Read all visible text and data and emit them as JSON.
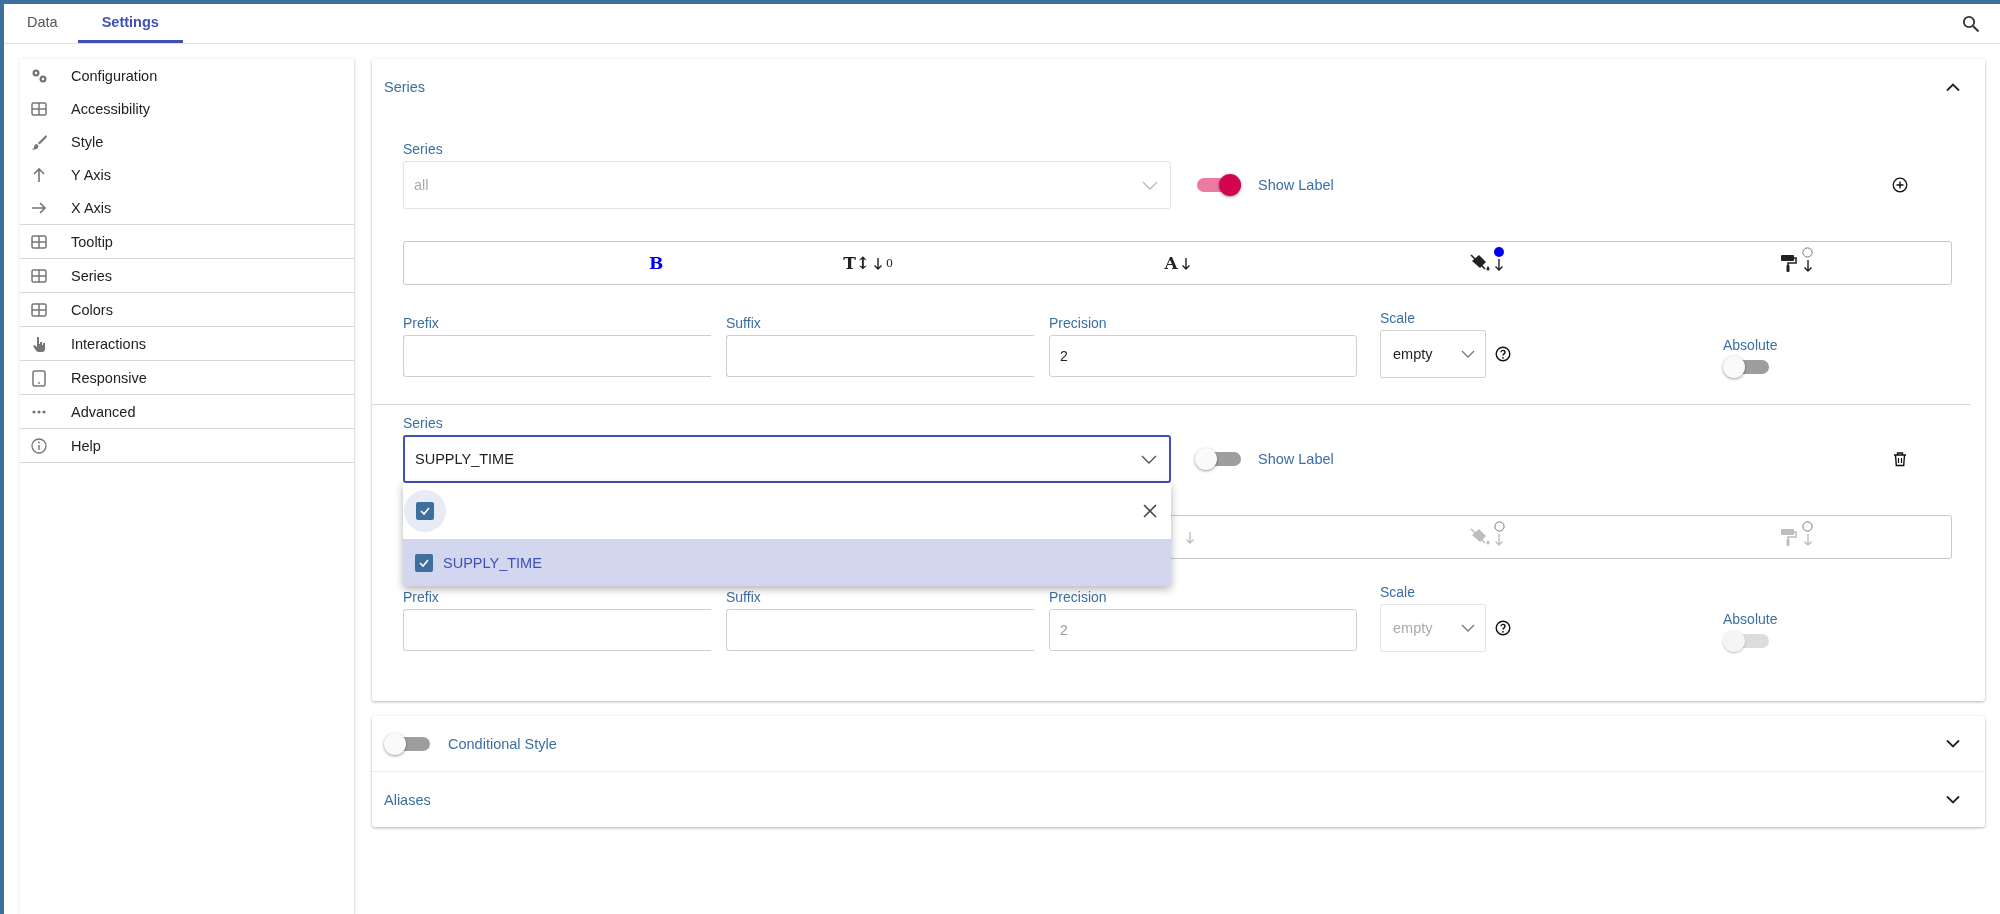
{
  "tabs": [
    {
      "label": "Data",
      "selected": false
    },
    {
      "label": "Settings",
      "selected": true
    }
  ],
  "sidebar": {
    "sections": [
      {
        "items": [
          {
            "label": "Configuration"
          },
          {
            "label": "Accessibility"
          },
          {
            "label": "Style"
          },
          {
            "label": "Y Axis"
          },
          {
            "label": "X Axis"
          }
        ]
      },
      {
        "items": [
          {
            "label": "Tooltip"
          }
        ]
      },
      {
        "items": [
          {
            "label": "Series"
          }
        ]
      },
      {
        "items": [
          {
            "label": "Colors"
          }
        ]
      },
      {
        "items": [
          {
            "label": "Interactions"
          }
        ]
      },
      {
        "items": [
          {
            "label": "Responsive"
          }
        ]
      },
      {
        "items": [
          {
            "label": "Advanced"
          }
        ]
      },
      {
        "items": [
          {
            "label": "Help"
          }
        ]
      }
    ]
  },
  "series_panel": {
    "title": "Series",
    "expanded": true,
    "entries": [
      {
        "label": "Series",
        "select": {
          "value": "all",
          "disabled": true,
          "focused": false
        },
        "show_label": {
          "label": "Show Label",
          "on": true
        },
        "action": {
          "kind": "add"
        },
        "disabled": false,
        "toolbar": [
          {
            "kind": "bold",
            "label": "B",
            "active": true
          },
          {
            "kind": "size",
            "label": "T↕",
            "value": "0"
          },
          {
            "kind": "font",
            "label": "A"
          },
          {
            "kind": "fill",
            "color": "#0000ff"
          },
          {
            "kind": "paint"
          }
        ],
        "fields": [
          {
            "kind": "text",
            "label": "Prefix"
          },
          {
            "kind": "text",
            "label": "Suffix"
          },
          {
            "kind": "text",
            "label": "Precision",
            "value": "2"
          },
          {
            "kind": "select",
            "label": "Scale",
            "value": "empty"
          },
          {
            "kind": "toggle",
            "label": "Absolute",
            "on": false
          }
        ]
      },
      {
        "label": "Series",
        "select": {
          "value": "SUPPLY_TIME",
          "disabled": false,
          "focused": true,
          "dropdown": {
            "select_all_checked": true,
            "options": [
              {
                "label": "SUPPLY_TIME",
                "checked": true,
                "selected": true
              }
            ]
          }
        },
        "show_label": {
          "label": "Show Label",
          "on": false
        },
        "action": {
          "kind": "delete"
        },
        "disabled": true,
        "toolbar": [
          {
            "kind": "font"
          },
          {
            "kind": "fill"
          },
          {
            "kind": "paint"
          }
        ],
        "fields": [
          {
            "kind": "text",
            "label": "Prefix"
          },
          {
            "kind": "text",
            "label": "Suffix"
          },
          {
            "kind": "text",
            "label": "Precision",
            "value": "2"
          },
          {
            "kind": "select",
            "label": "Scale",
            "value": "empty"
          },
          {
            "kind": "toggle",
            "label": "Absolute",
            "on": false
          }
        ]
      }
    ]
  },
  "bottom_panels": [
    {
      "title": "Conditional Style",
      "toggle": {
        "on": false
      },
      "expanded": false
    },
    {
      "title": "Aliases",
      "expanded": false
    }
  ]
}
